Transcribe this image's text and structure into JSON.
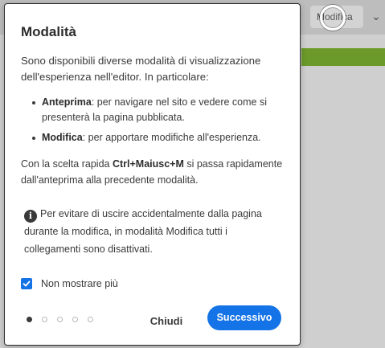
{
  "background": {
    "mode_button_label": "Modifica",
    "chevron_glyph": "⌄"
  },
  "dialog": {
    "title": "Modalità",
    "intro": "Sono disponibili diverse modalità di visualizzazione dell'esperienza nell'editor. In particolare:",
    "bullets": [
      {
        "term": "Anteprima",
        "text": ": per navigare nel sito e vedere come si presenterà la pagina pubblicata."
      },
      {
        "term": "Modifica",
        "text": ": per apportare modifiche all'esperienza."
      }
    ],
    "shortcut": {
      "before": "Con la scelta rapida ",
      "keys": "Ctrl+Maiusc+M",
      "after": " si passa rapidamente dall'anteprima alla precedente modalità."
    },
    "notice": "Per evitare di uscire accidentalmente dalla pagina durante la modifica, in modalità Modifica tutti i collegamenti sono disattivati.",
    "info_icon_glyph": "i",
    "checkbox": {
      "label": "Non mostrare più",
      "checked": true
    },
    "pager": {
      "total": 5,
      "current": 1
    },
    "close_label": "Chiudi",
    "next_label": "Successivo"
  },
  "colors": {
    "accent": "#1473e6",
    "brand_band": "#6c9a2a"
  }
}
